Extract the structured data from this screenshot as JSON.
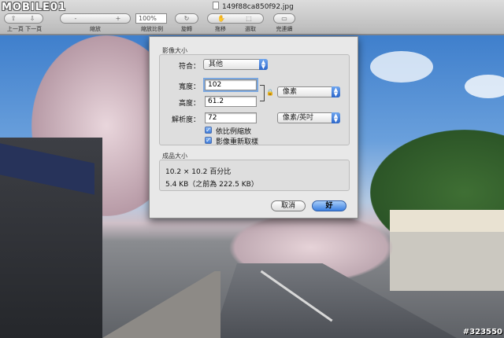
{
  "window": {
    "filename": "149f88ca850f92.jpg"
  },
  "logo": {
    "text": "MOBILE01"
  },
  "toolbar": {
    "prev_next_label": "上一頁  下一頁",
    "zoom_label": "縮放",
    "zoom_value": "100%",
    "zoom_pct_label": "縮放比例",
    "rotate_label": "旋轉",
    "move_label": "拖移",
    "select_label": "選取",
    "done_label": "完連續",
    "minus_icon": "-",
    "plus_icon": "+"
  },
  "dialog": {
    "section_title": "影像大小",
    "fit_label": "符合：",
    "fit_value": "其他",
    "width_label": "寬度：",
    "width_value": "102",
    "height_label": "高度：",
    "height_value": "61.2",
    "units_value": "像素",
    "resolution_label": "解析度：",
    "resolution_value": "72",
    "resolution_units_value": "像素/英吋",
    "scale_checkbox_label": "依比例縮放",
    "resample_checkbox_label": "影像重新取樣",
    "result_title": "成品大小",
    "result_dimensions": "10.2 × 10.2 百分比",
    "result_size": "5.4 KB（之前為 222.5 KB）",
    "cancel_label": "取消",
    "ok_label": "好"
  },
  "watermark": {
    "text": "#323550"
  },
  "icons": {
    "popup_arrows": "updown-arrows-icon",
    "lock": "lock-icon",
    "check": "checkmark-icon"
  },
  "colors": {
    "accent_blue": "#3b7fe0",
    "dialog_bg": "#e8e8e8"
  }
}
